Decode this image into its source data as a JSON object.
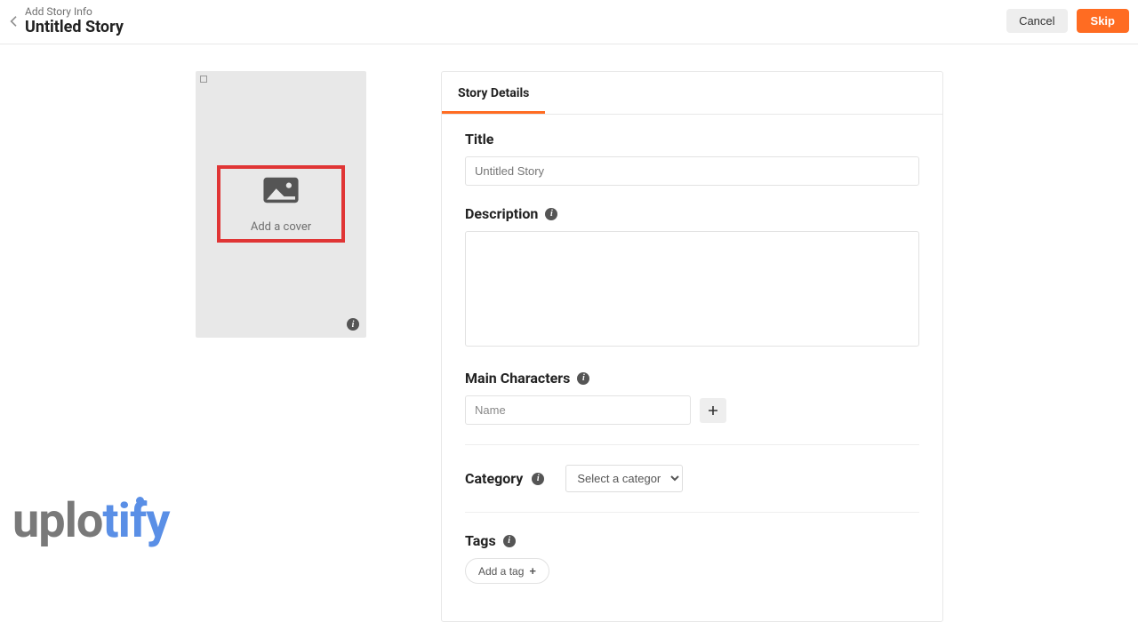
{
  "header": {
    "breadcrumb": "Add Story Info",
    "title": "Untitled Story",
    "cancel_label": "Cancel",
    "skip_label": "Skip"
  },
  "cover": {
    "add_cover_text": "Add a cover"
  },
  "tabs": {
    "story_details": "Story Details"
  },
  "form": {
    "title_label": "Title",
    "title_placeholder": "Untitled Story",
    "description_label": "Description",
    "main_characters_label": "Main Characters",
    "name_placeholder": "Name",
    "category_label": "Category",
    "category_placeholder": "Select a category",
    "tags_label": "Tags",
    "add_tag_label": "Add a tag"
  },
  "watermark": {
    "part1": "uplo",
    "part2": "tify"
  }
}
